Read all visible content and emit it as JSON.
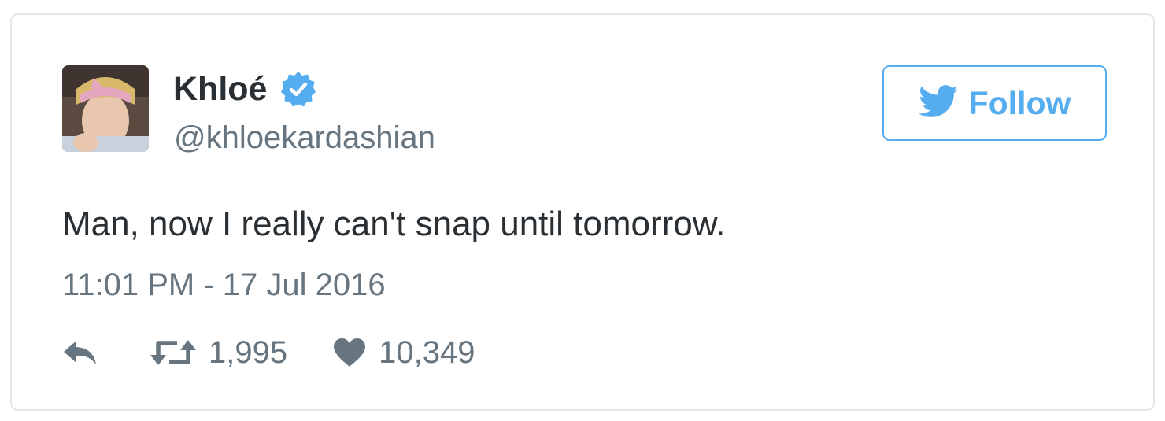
{
  "tweet": {
    "display_name": "Khloé",
    "handle": "@khloekardashian",
    "verified": true,
    "text": "Man, now I really can't snap until tomorrow.",
    "timestamp": "11:01 PM - 17 Jul 2016",
    "follow_label": "Follow",
    "retweet_count": "1,995",
    "like_count": "10,349"
  },
  "icons": {
    "verified": "verified-badge-icon",
    "follow": "twitter-bird-icon",
    "reply": "reply-icon",
    "retweet": "retweet-icon",
    "like": "heart-icon"
  },
  "colors": {
    "accent": "#55acee",
    "verified": "#55acee",
    "text": "#292f33",
    "secondary_text": "#66757f",
    "icon": "#66757f",
    "border": "#e1e8ed"
  }
}
